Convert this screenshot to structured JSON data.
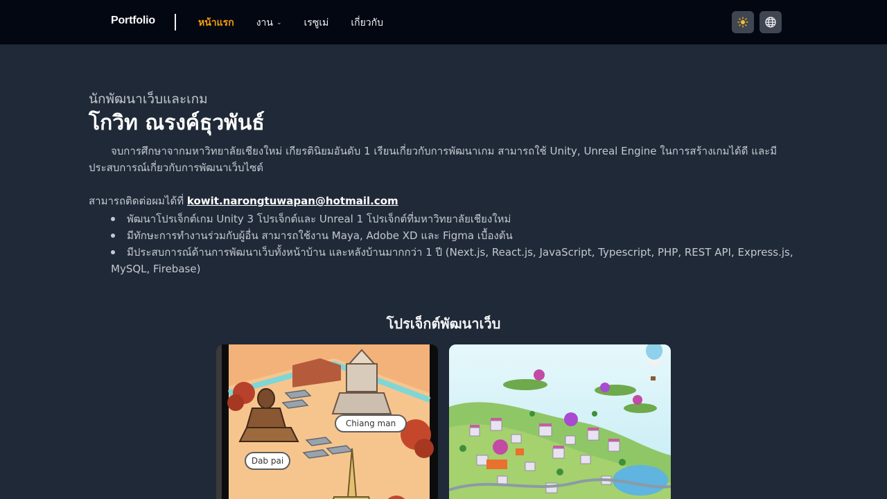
{
  "navbar": {
    "brand": "Portfolio",
    "links": [
      {
        "label": "หน้าแรก",
        "active": true
      },
      {
        "label": "งาน",
        "dropdown": true
      },
      {
        "label": "เรซูเม่"
      },
      {
        "label": "เกี่ยวกับ"
      }
    ],
    "theme_icon": "sun-icon",
    "language_icon": "globe-icon",
    "accent_color": "#f59e0b"
  },
  "hero": {
    "subtitle": "นักพัฒนาเว็บและเกม",
    "name": "โกวิท ณรงค์ธุวพันธ์",
    "bio": "จบการศึกษาจากมหาวิทยาลัยเชียงใหม่ เกียรตินิยมอันดับ 1 เรียนเกี่ยวกับการพัฒนาเกม สามารถใช้ Unity, Unreal Engine ในการสร้างเกมได้ดี และมีประสบการณ์เกี่ยวกับการพัฒนาเว็บไซต์",
    "contact_prefix": "สามารถติดต่อผมได้ที่",
    "email": "kowit.narongtuwapan@hotmail.com",
    "bullets": [
      "พัฒนาโปรเจ็กต์เกม Unity 3 โปรเจ็กต์และ Unreal 1 โปรเจ็กต์ที่มหาวิทยาลัยเชียงใหม่",
      "มีทักษะการทำงานร่วมกับผู้อื่น สามารถใช้งาน Maya, Adobe XD และ Figma เบื้องต้น",
      "มีประสบการณ์ด้านการพัฒนาเว็บทั้งหน้าบ้าน และหลังบ้านมากกว่า 1 ปี (Next.js, React.js, JavaScript, Typescript, PHP, REST API, Express.js, MySQL, Firebase)"
    ]
  },
  "projects": {
    "title": "โปรเจ็กต์พัฒนาเว็บ",
    "cards": [
      {
        "labels": [
          "Chiang man",
          "Dab pai"
        ]
      },
      {
        "labels": []
      }
    ]
  }
}
